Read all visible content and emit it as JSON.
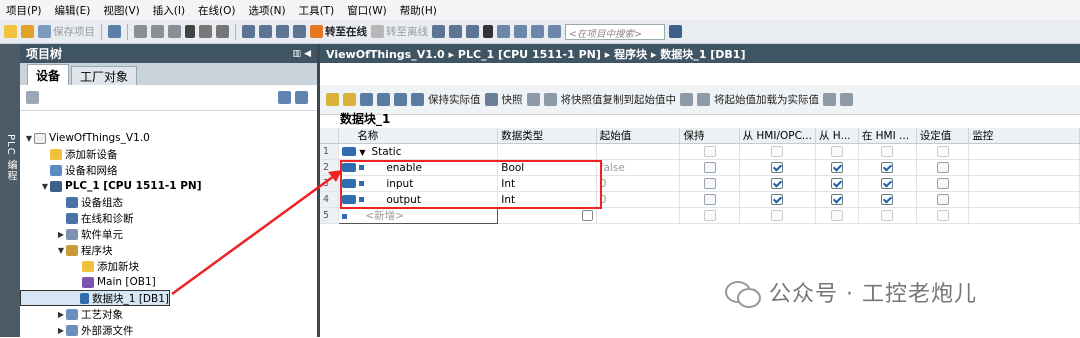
{
  "menu": [
    "项目(P)",
    "编辑(E)",
    "视图(V)",
    "插入(I)",
    "在线(O)",
    "选项(N)",
    "工具(T)",
    "窗口(W)",
    "帮助(H)"
  ],
  "toolbar": {
    "save_project": "保存项目",
    "go_online": "转至在线",
    "go_offline": "转至离线",
    "search_placeholder": "<在项目中搜索>"
  },
  "left_strip_label": "PLC 编程",
  "project_tree": {
    "title": "项目树",
    "tabs": [
      "设备",
      "工厂对象"
    ],
    "items": [
      {
        "label": "ViewOfThings_V1.0",
        "indent": 0,
        "arrow": "▼"
      },
      {
        "label": "添加新设备",
        "indent": 1,
        "arrow": ""
      },
      {
        "label": "设备和网络",
        "indent": 1,
        "arrow": ""
      },
      {
        "label": "PLC_1 [CPU 1511-1 PN]",
        "indent": 1,
        "arrow": "▼"
      },
      {
        "label": "设备组态",
        "indent": 2,
        "arrow": ""
      },
      {
        "label": "在线和诊断",
        "indent": 2,
        "arrow": ""
      },
      {
        "label": "软件单元",
        "indent": 2,
        "arrow": "▶"
      },
      {
        "label": "程序块",
        "indent": 2,
        "arrow": "▼"
      },
      {
        "label": "添加新块",
        "indent": 3,
        "arrow": ""
      },
      {
        "label": "Main [OB1]",
        "indent": 3,
        "arrow": ""
      },
      {
        "label": "数据块_1 [DB1]",
        "indent": 3,
        "arrow": ""
      },
      {
        "label": "工艺对象",
        "indent": 2,
        "arrow": "▶"
      },
      {
        "label": "外部源文件",
        "indent": 2,
        "arrow": "▶"
      }
    ]
  },
  "breadcrumb": "ViewOfThings_V1.0 ▸ PLC_1 [CPU 1511-1 PN] ▸ 程序块 ▸ 数据块_1 [DB1]",
  "editor_toolbar": {
    "keep_actual": "保持实际值",
    "snapshot": "快照",
    "copy_snapshot": "将快照值复制到起始值中",
    "load_start": "将起始值加载为实际值"
  },
  "db_title": "数据块_1",
  "columns": [
    "名称",
    "数据类型",
    "起始值",
    "保持",
    "从 HMI/OPC...",
    "从 H...",
    "在 HMI ...",
    "设定值",
    "监控"
  ],
  "rows": [
    {
      "num": "1",
      "name": "Static",
      "type": "",
      "start": "",
      "retain": false,
      "hmi1": false,
      "hmi2": false,
      "hmi3": false,
      "setpoint": false,
      "kind": "struct"
    },
    {
      "num": "2",
      "name": "enable",
      "type": "Bool",
      "start": "false",
      "retain": false,
      "hmi1": true,
      "hmi2": true,
      "hmi3": true,
      "setpoint": false,
      "kind": "var"
    },
    {
      "num": "3",
      "name": "input",
      "type": "Int",
      "start": "0",
      "retain": false,
      "hmi1": true,
      "hmi2": true,
      "hmi3": true,
      "setpoint": false,
      "kind": "var"
    },
    {
      "num": "4",
      "name": "output",
      "type": "Int",
      "start": "0",
      "retain": false,
      "hmi1": true,
      "hmi2": true,
      "hmi3": true,
      "setpoint": false,
      "kind": "var"
    },
    {
      "num": "5",
      "name": "<新增>",
      "type": "",
      "start": "",
      "retain": false,
      "hmi1": false,
      "hmi2": false,
      "hmi3": false,
      "setpoint": false,
      "kind": "new"
    }
  ],
  "watermark": "公众号 · 工控老炮儿",
  "colors": {
    "header_bar": "#3f5564",
    "annotation": "#ee2222",
    "checkbox_check": "#1b5fa8"
  }
}
